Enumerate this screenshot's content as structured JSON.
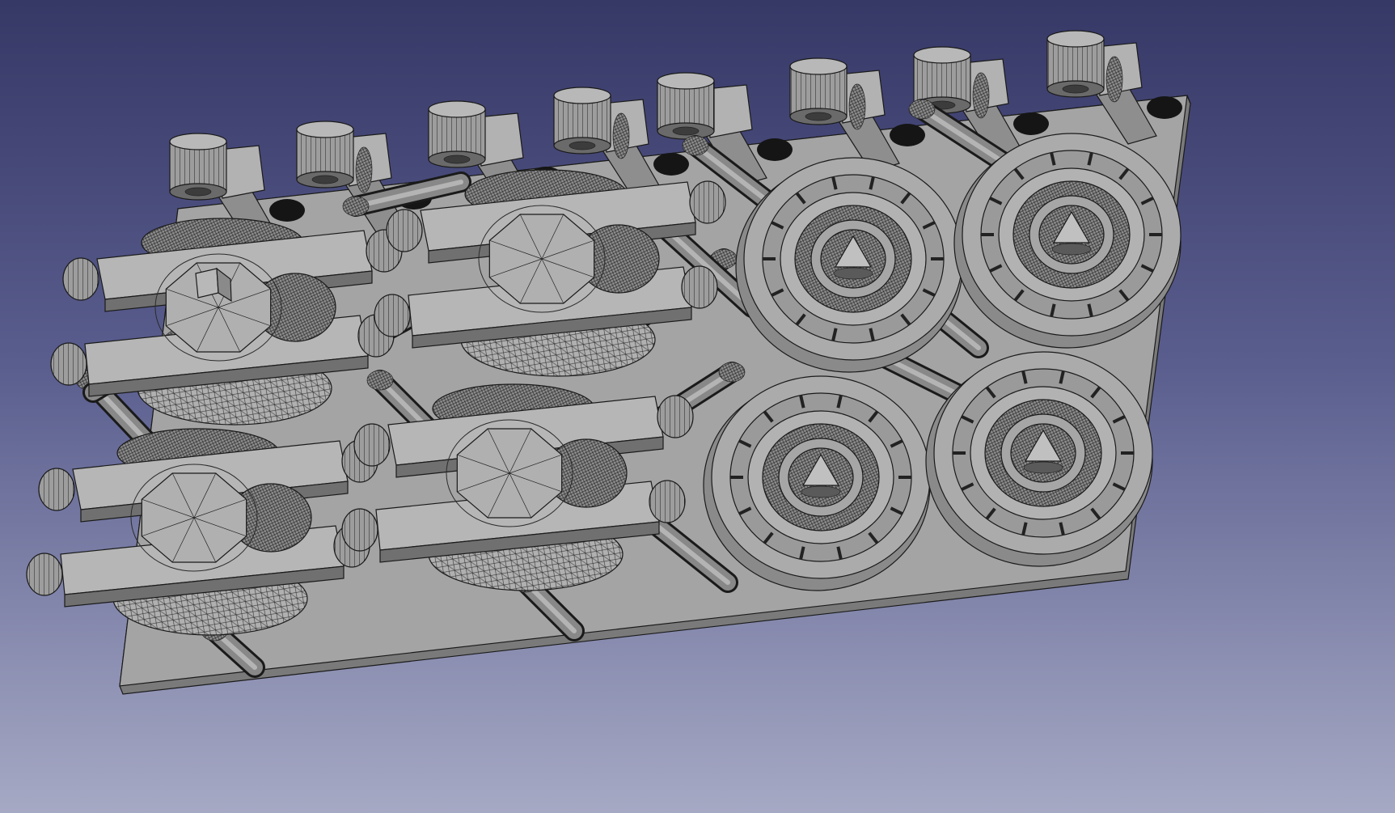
{
  "viewer": {
    "background_top": "#363866",
    "background_bottom": "#a6a9c4",
    "model_face_color": "#a8a8a8",
    "model_edge_color": "#1a1a1a",
    "display_mode": "Flat Lines"
  },
  "model": {
    "parts": [
      {
        "type": "carriage-assembly",
        "count": 4
      },
      {
        "type": "round-gear-housing",
        "count": 4
      },
      {
        "type": "cylindrical-post-with-arm",
        "count": 9
      },
      {
        "type": "angled-rod",
        "count": 12
      },
      {
        "type": "base-plate",
        "count": 1
      }
    ]
  }
}
